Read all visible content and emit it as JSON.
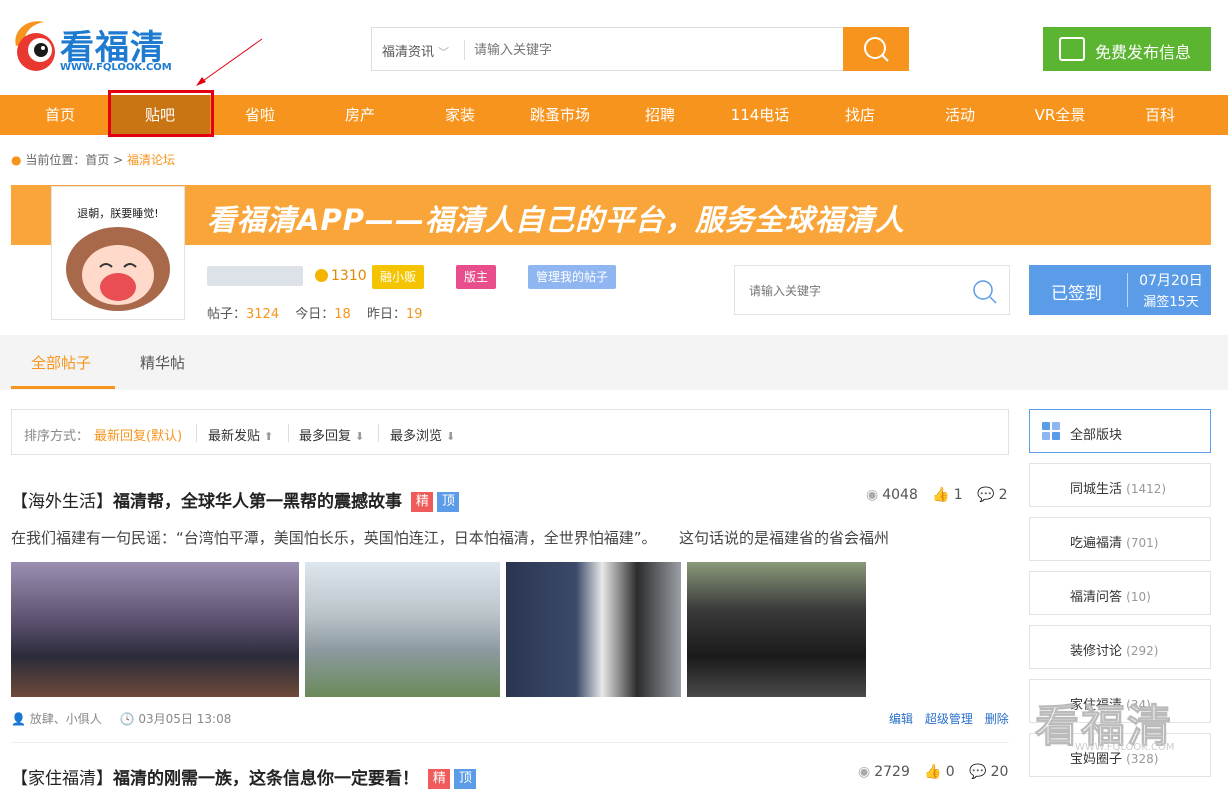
{
  "logo": {
    "name": "看福清",
    "url": "WWW.FQLOOK.COM"
  },
  "search": {
    "category": "福清资讯",
    "placeholder": "请输入关键字"
  },
  "publish_label": "免费发布信息",
  "nav": [
    "首页",
    "贴吧",
    "省啦",
    "房产",
    "家装",
    "跳蚤市场",
    "招聘",
    "114电话",
    "找店",
    "活动",
    "VR全景",
    "百科"
  ],
  "nav_active": "贴吧",
  "breadcrumb": {
    "prefix": "当前位置：",
    "home": "首页",
    "current": "福清论坛"
  },
  "banner_text": "看福清APP——福清人自己的平台，服务全球福清人",
  "avatar_text": "退朝，朕要睡觉!",
  "profile": {
    "coins": "1310",
    "badges": [
      "融小贩",
      "版主",
      "管理我的帖子"
    ],
    "posts_label": "帖子：",
    "posts": "3124",
    "today_label": "今日：",
    "today": "18",
    "yesterday_label": "昨日：",
    "yesterday": "19"
  },
  "profile_search_placeholder": "请输入关键字",
  "signin": {
    "status": "已签到",
    "date": "07月20日",
    "streak": "漏签15天"
  },
  "tabs": [
    "全部帖子",
    "精华帖"
  ],
  "sort": {
    "label": "排序方式：",
    "options": [
      "最新回复(默认)",
      "最新发贴",
      "最多回复",
      "最多浏览"
    ]
  },
  "posts": [
    {
      "category": "【海外生活】",
      "title": "福清帮，全球华人第一黑帮的震撼故事",
      "tags": [
        "精",
        "顶"
      ],
      "views": "4048",
      "likes": "1",
      "comments": "2",
      "excerpt": "在我们福建有一句民谣：“台湾怕平潭，美国怕长乐，英国怕连江，日本怕福清，全世界怕福建”。　　这句话说的是福建省的省会福州",
      "author": "放肆、小俱人",
      "date": "03月05日 13:08",
      "admin": [
        "编辑",
        "超级管理",
        "删除"
      ]
    },
    {
      "category": "【家住福清】",
      "title": "福清的刚需一族，这条信息你一定要看！",
      "tags": [
        "精",
        "顶"
      ],
      "views": "2729",
      "likes": "0",
      "comments": "20"
    }
  ],
  "sidebar": {
    "all": "全部版块",
    "items": [
      {
        "name": "同城生活",
        "count": "(1412)"
      },
      {
        "name": "吃遍福清",
        "count": "(701)"
      },
      {
        "name": "福清问答",
        "count": "(10)"
      },
      {
        "name": "装修讨论",
        "count": "(292)"
      },
      {
        "name": "家住福清",
        "count": "(34)"
      },
      {
        "name": "宝妈圈子",
        "count": "(328)"
      }
    ]
  },
  "watermark": {
    "text": "看福清",
    "url": "WWW.FQLOOK.COM"
  },
  "colors": {
    "orange": "#f7941d",
    "green": "#5cb531",
    "blue": "#5b9ce8",
    "red_box": "#e4000f"
  }
}
